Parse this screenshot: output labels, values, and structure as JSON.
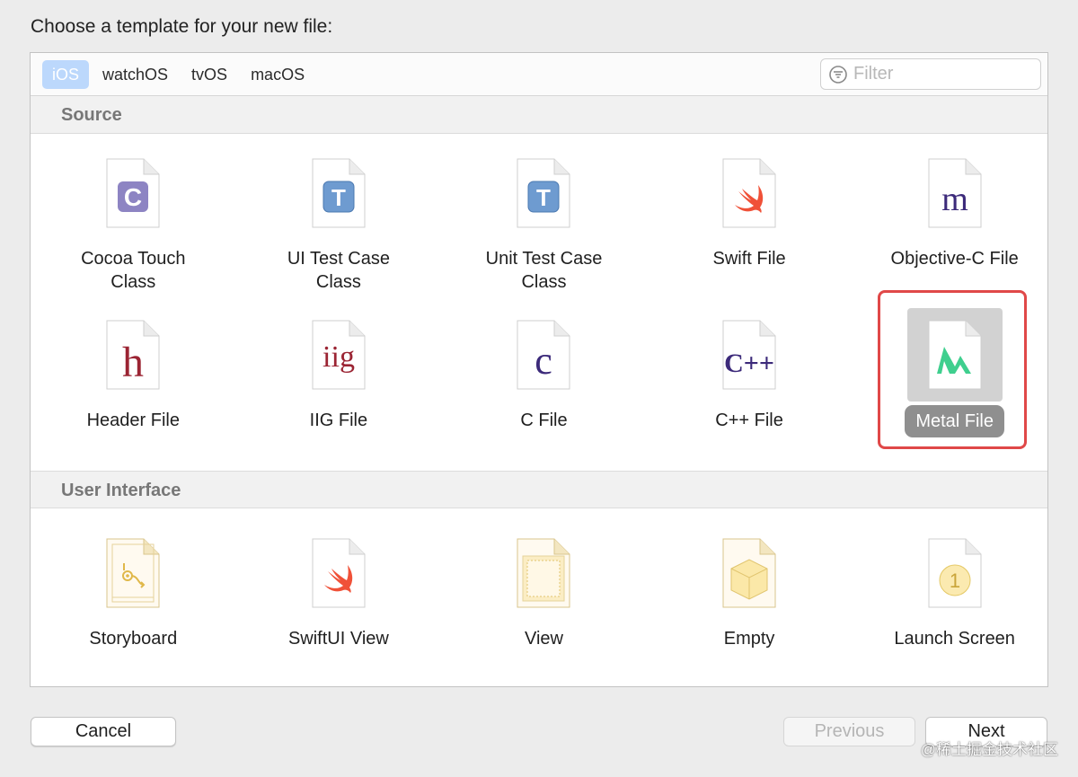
{
  "dialog": {
    "title": "Choose a template for your new file:"
  },
  "platform_tabs": [
    {
      "label": "iOS",
      "active": true
    },
    {
      "label": "watchOS",
      "active": false
    },
    {
      "label": "tvOS",
      "active": false
    },
    {
      "label": "macOS",
      "active": false
    }
  ],
  "filter": {
    "placeholder": "Filter",
    "icon": "filter-icon"
  },
  "sections": [
    {
      "title": "Source",
      "items": [
        {
          "label": "Cocoa Touch\nClass",
          "icon": "cocoa-touch-class-icon",
          "glyph": "C"
        },
        {
          "label": "UI Test Case\nClass",
          "icon": "ui-test-case-icon",
          "glyph": "T"
        },
        {
          "label": "Unit Test Case\nClass",
          "icon": "unit-test-case-icon",
          "glyph": "T"
        },
        {
          "label": "Swift File",
          "icon": "swift-icon"
        },
        {
          "label": "Objective-C File",
          "icon": "objective-c-icon",
          "glyph": "m"
        },
        {
          "label": "Header File",
          "icon": "header-file-icon",
          "glyph": "h"
        },
        {
          "label": "IIG File",
          "icon": "iig-file-icon",
          "glyph": "iig"
        },
        {
          "label": "C File",
          "icon": "c-file-icon",
          "glyph": "c"
        },
        {
          "label": "C++ File",
          "icon": "cpp-file-icon",
          "glyph": "C++"
        },
        {
          "label": "Metal File",
          "icon": "metal-file-icon",
          "selected": true
        }
      ]
    },
    {
      "title": "User Interface",
      "items": [
        {
          "label": "Storyboard",
          "icon": "storyboard-icon"
        },
        {
          "label": "SwiftUI View",
          "icon": "swiftui-view-icon"
        },
        {
          "label": "View",
          "icon": "view-icon"
        },
        {
          "label": "Empty",
          "icon": "empty-icon"
        },
        {
          "label": "Launch Screen",
          "icon": "launch-screen-icon",
          "glyph": "1"
        }
      ]
    }
  ],
  "buttons": {
    "cancel": "Cancel",
    "previous": "Previous",
    "next": "Next"
  },
  "watermark": "@稀土掘金技术社区",
  "colors": {
    "selection_border": "#e04848",
    "active_tab": "#bcd8fc",
    "selected_label_bg": "#8f8f8f",
    "cocoa_purple": "#8d84c3",
    "test_blue": "#6e9bd0",
    "objc_purple": "#3c2a7a",
    "header_red": "#9b2433",
    "swift_orange": "#f05138",
    "metal_green": "#3fcf8e",
    "ui_yellow": "#f0d88a"
  }
}
